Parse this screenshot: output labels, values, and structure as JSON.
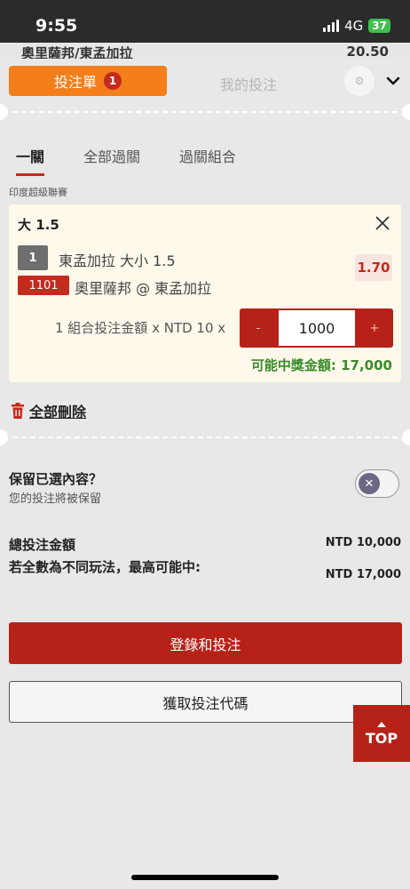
{
  "status_bar": {
    "time": "9:55",
    "network": "4G",
    "battery": "37"
  },
  "behind": {
    "match_text": "奧里薩邦/東孟加拉",
    "amount_text": "20.50"
  },
  "header": {
    "tab_betslip": "投注單",
    "betslip_count": "1",
    "tab_my_bets": "我的投注"
  },
  "subtabs": [
    "一關",
    "全部過關",
    "過關組合"
  ],
  "league": "印度超級聯賽",
  "bet": {
    "title": "大 1.5",
    "selection_no": "1",
    "selection": "東孟加拉 大小 1.5",
    "odds": "1.70",
    "event_code": "1101",
    "event_name": "奧里薩邦 @ 東孟加拉",
    "combo_label": "1 組合投注金額 x NTD 10 x",
    "minus": "-",
    "plus": "+",
    "stake": "1000",
    "potential_win": "可能中獎金額: 17,000"
  },
  "delete_all": "全部刪除",
  "retain": {
    "title": "保留已選內容？",
    "subtitle": "您的投注將被保留"
  },
  "totals": {
    "total_label": "總投注金額",
    "total_value": "NTD 10,000",
    "max_label": "若全數為不同玩法，最高可能中:",
    "max_value": "NTD 17,000"
  },
  "buttons": {
    "login_bet": "登錄和投注",
    "get_code": "獲取投注代碼",
    "top": "TOP"
  },
  "colors": {
    "accent_orange": "#f37e1a",
    "brand_red": "#b62218",
    "win_green": "#3a8a2a"
  }
}
